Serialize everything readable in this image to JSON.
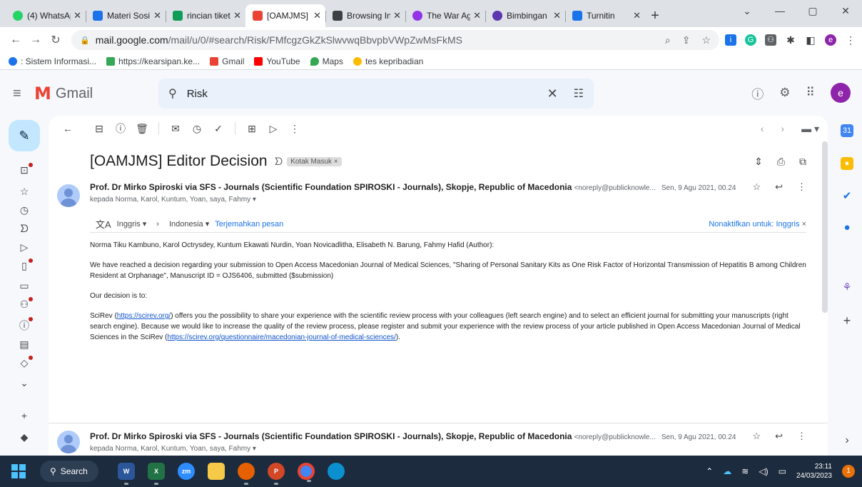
{
  "browser": {
    "tabs": [
      {
        "label": "(4) WhatsAp",
        "color": "#25d366"
      },
      {
        "label": "Materi Sosi",
        "color": "#1a73e8"
      },
      {
        "label": "rincian tiket",
        "color": "#0f9d58"
      },
      {
        "label": "[OAMJMS]",
        "color": "#ea4335"
      },
      {
        "label": "Browsing In",
        "color": "#3c4043"
      },
      {
        "label": "The War Ag",
        "color": "#9334e6"
      },
      {
        "label": "Bimbingan",
        "color": "#5e35b1"
      },
      {
        "label": "Turnitin",
        "color": "#1a73e8"
      }
    ],
    "url_host": "mail.google.com",
    "url_path": "/mail/u/0/#search/Risk/FMfcgzGkZkSlwvwqBbvpbVWpZwMsFkMS",
    "bookmarks": [
      {
        "label": ": Sistem Informasi...",
        "color": "#1a73e8"
      },
      {
        "label": "https://kearsipan.ke...",
        "color": "#34a853"
      },
      {
        "label": "Gmail",
        "color": "#ea4335"
      },
      {
        "label": "YouTube",
        "color": "#ff0000"
      },
      {
        "label": "Maps",
        "color": "#34a853"
      },
      {
        "label": "tes kepribadian",
        "color": "#fbbc04"
      }
    ]
  },
  "gmail": {
    "logo_text": "Gmail",
    "search_value": "Risk",
    "avatar_letter": "e"
  },
  "email": {
    "subject": "[OAMJMS] Editor Decision",
    "label": "Kotak Masuk",
    "label_close": "×",
    "sender": "Prof. Dr Mirko Spiroski via SFS - Journals (Scientific Foundation SPIROSKI - Journals), Skopje, Republic of Macedonia",
    "sender_email": "<noreply@publicknowle...",
    "date": "Sen, 9 Agu 2021, 00.24",
    "to": "kepada Norma, Karol, Kuntum, Yoan, saya, Fahmy",
    "translate": {
      "from_lang": "Inggris",
      "to_lang": "Indonesia",
      "translate_link": "Terjemahkan pesan",
      "disable_link": "Nonaktifkan untuk: Inggris"
    },
    "body": {
      "greeting": "Norma Tiku Kambuno, Karol Octrysdey, Kuntum Ekawati Nurdin, Yoan Novicadlitha, Elisabeth N. Barung, Fahmy Hafid (Author):",
      "para1": "We have reached a decision regarding your submission to Open Access Macedonian Journal of Medical Sciences, \"Sharing of Personal Sanitary Kits as One Risk Factor of Horizontal Transmission of Hepatitis B among Children Resident at Orphanage\", Manuscript ID = OJS6406, submitted ($submission)",
      "para2": "Our decision is to:",
      "para3_a": "SciRev (",
      "link1": "https://scirev.org/",
      "para3_b": ") offers you the possibility to share your experience with the scientific review process with your colleagues (left search engine) and to select an efficient journal for submitting your manuscripts (right search engine). Because we would like to increase the quality of the review process, please register and submit your experience with the review process of your article published in Open Access Macedonian Journal of Medical Sciences in the SciRev (",
      "link2": "https://scirev.org/questionnaire/macedonian-journal-of-medical-sciences/",
      "para3_c": ")."
    }
  },
  "email2": {
    "sender": "Prof. Dr Mirko Spiroski via SFS - Journals (Scientific Foundation SPIROSKI - Journals), Skopje, Republic of Macedonia",
    "sender_email": "<noreply@publicknowle...",
    "date": "Sen, 9 Agu 2021, 00.24",
    "to": "kepada Norma, Karol, Kuntum, Yoan, saya, Fahmy"
  },
  "taskbar": {
    "search_label": "Search",
    "time": "23:11",
    "date": "24/03/2023",
    "notif_count": "1"
  }
}
